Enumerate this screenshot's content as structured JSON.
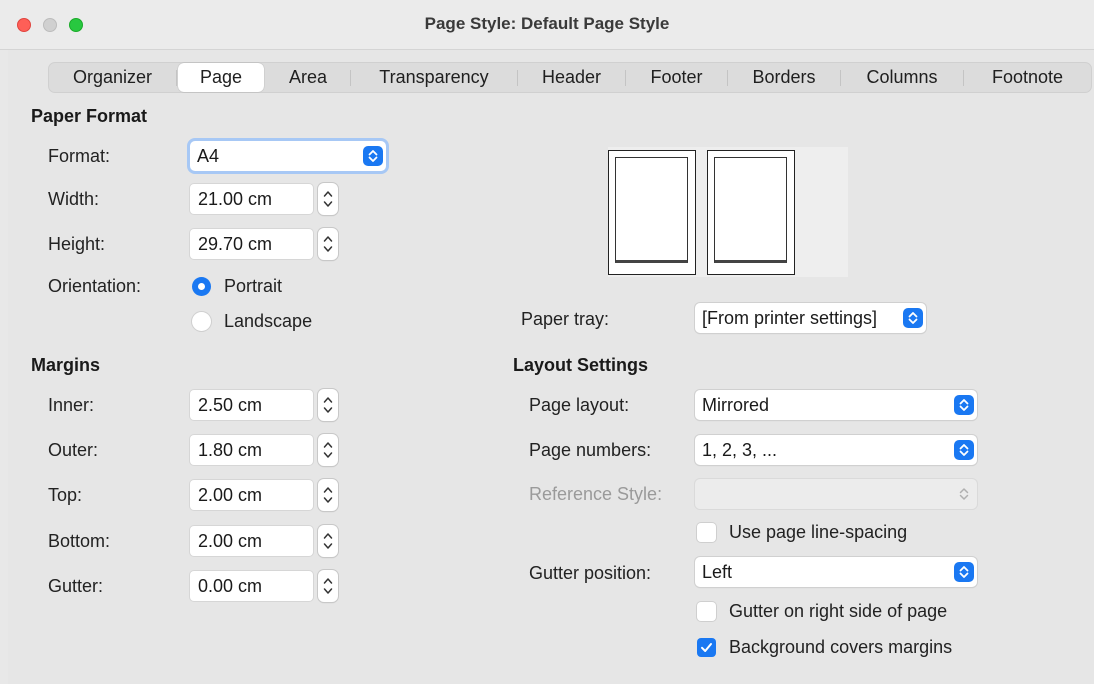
{
  "window": {
    "title": "Page Style: Default Page Style"
  },
  "tabs": [
    {
      "label": "Organizer"
    },
    {
      "label": "Page"
    },
    {
      "label": "Area"
    },
    {
      "label": "Transparency"
    },
    {
      "label": "Header"
    },
    {
      "label": "Footer"
    },
    {
      "label": "Borders"
    },
    {
      "label": "Columns"
    },
    {
      "label": "Footnote"
    }
  ],
  "active_tab": "Page",
  "paper_format": {
    "heading": "Paper Format",
    "format_label": "Format:",
    "format_value": "A4",
    "width_label": "Width:",
    "width_value": "21.00 cm",
    "height_label": "Height:",
    "height_value": "29.70 cm",
    "orientation_label": "Orientation:",
    "portrait_label": "Portrait",
    "landscape_label": "Landscape",
    "orientation_selected": "Portrait"
  },
  "margins": {
    "heading": "Margins",
    "inner_label": "Inner:",
    "inner_value": "2.50 cm",
    "outer_label": "Outer:",
    "outer_value": "1.80 cm",
    "top_label": "Top:",
    "top_value": "2.00 cm",
    "bottom_label": "Bottom:",
    "bottom_value": "2.00 cm",
    "gutter_label": "Gutter:",
    "gutter_value": "0.00 cm"
  },
  "paper_tray": {
    "label": "Paper tray:",
    "value": "[From printer settings]"
  },
  "layout_settings": {
    "heading": "Layout Settings",
    "page_layout_label": "Page layout:",
    "page_layout_value": "Mirrored",
    "page_numbers_label": "Page numbers:",
    "page_numbers_value": "1, 2, 3, ...",
    "reference_style_label": "Reference Style:",
    "reference_style_value": "",
    "use_line_spacing_label": "Use page line-spacing",
    "use_line_spacing_checked": false,
    "gutter_position_label": "Gutter position:",
    "gutter_position_value": "Left",
    "gutter_right_label": "Gutter on right side of page",
    "gutter_right_checked": false,
    "background_covers_label": "Background covers margins",
    "background_covers_checked": true
  },
  "colors": {
    "accent": "#1a78f2",
    "close": "#fe5f57",
    "zoom": "#28c840"
  }
}
